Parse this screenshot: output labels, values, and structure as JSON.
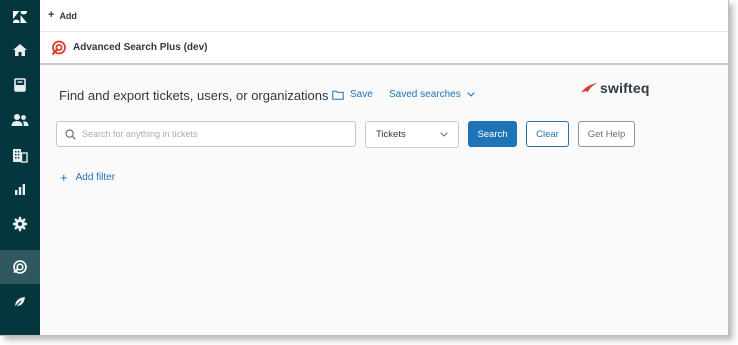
{
  "colors": {
    "nav_bg": "#03363d",
    "nav_active": "#30595e",
    "accent": "#1f73b7",
    "brand_red": "#d93f2c"
  },
  "nav": {
    "items": [
      {
        "name": "zendesk-logo-icon",
        "active": false
      },
      {
        "name": "home-icon",
        "active": false
      },
      {
        "name": "views-icon",
        "active": false
      },
      {
        "name": "customers-icon",
        "active": false
      },
      {
        "name": "organizations-icon",
        "active": false
      },
      {
        "name": "reporting-icon",
        "active": false
      },
      {
        "name": "admin-gear-icon",
        "active": false
      },
      {
        "name": "advanced-search-app-icon",
        "active": true
      },
      {
        "name": "leaf-app-icon",
        "active": false
      }
    ]
  },
  "topbar": {
    "add_label": "Add"
  },
  "app": {
    "title": "Advanced Search Plus (dev)"
  },
  "main": {
    "heading": "Find and export tickets, users, or organizations",
    "save_label": "Save",
    "saved_searches_label": "Saved searches",
    "logo_text": "swifteq",
    "search_placeholder": "Search for anything in tickets",
    "search_value": "",
    "type_select": {
      "selected": "Tickets"
    },
    "search_button": "Search",
    "clear_button": "Clear",
    "help_button": "Get Help",
    "add_filter_label": "Add filter"
  }
}
